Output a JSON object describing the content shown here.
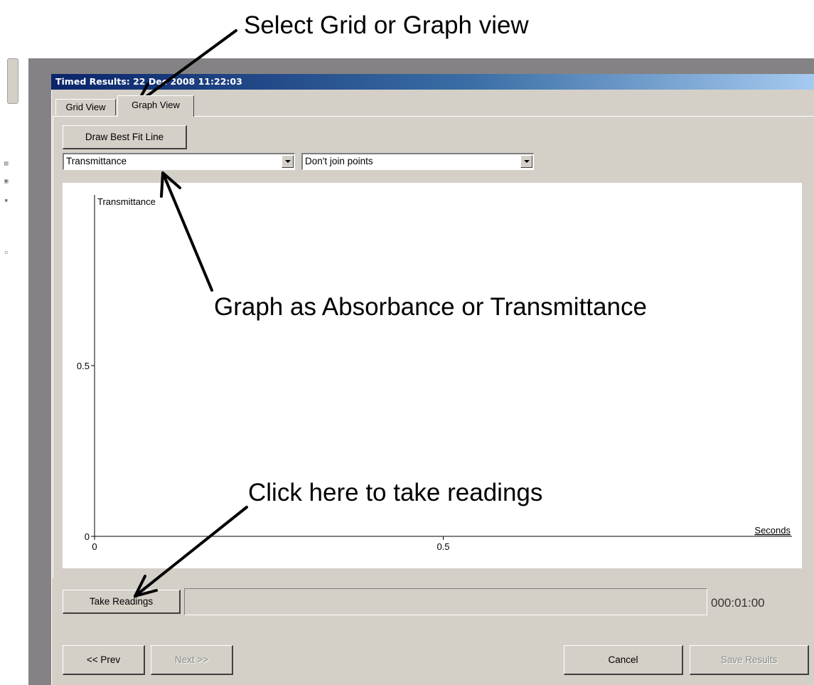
{
  "window": {
    "title": "Timed Results: 22 Dec 2008 11:22:03"
  },
  "tabs": [
    {
      "label": "Grid View"
    },
    {
      "label": "Graph View"
    }
  ],
  "toolbar": {
    "best_fit_label": "Draw Best Fit Line",
    "measure_select_value": "Transmittance",
    "join_select_value": "Don't join points"
  },
  "chart_data": {
    "type": "scatter",
    "series": [],
    "ylabel": "Transmittance",
    "xlabel": "Seconds",
    "xlim": [
      0,
      1
    ],
    "ylim": [
      0,
      1
    ],
    "x_ticks": [
      {
        "value": 0,
        "label": "0"
      },
      {
        "value": 0.5,
        "label": "0.5"
      }
    ],
    "y_ticks": [
      {
        "value": 0,
        "label": "0"
      },
      {
        "value": 0.5,
        "label": "0.5"
      }
    ],
    "grid": false
  },
  "bottom": {
    "take_readings_label": "Take Readings",
    "timer": "000:01:00",
    "progress": 0
  },
  "nav": {
    "prev_label": "<< Prev",
    "next_label": "Next >>",
    "cancel_label": "Cancel",
    "save_label": "Save Results"
  },
  "callouts": {
    "select_view": "Select Grid or Graph view",
    "graph_as": "Graph as Absorbance or Transmittance",
    "take_readings": "Click here to take readings"
  },
  "colors": {
    "title_gradient_start": "#0a246a",
    "title_gradient_end": "#a6caf0",
    "dialog_face": "#d4d0c8"
  }
}
